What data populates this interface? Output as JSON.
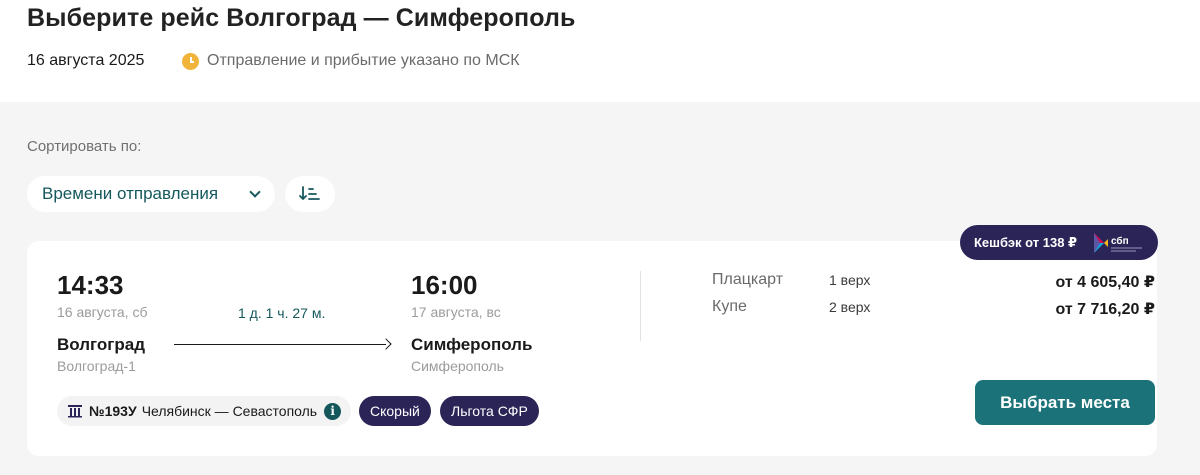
{
  "header": {
    "title": "Выберите рейс Волгоград — Симферополь",
    "date": "16 августа 2025",
    "timezone_note": "Отправление и прибытие указано по МСК"
  },
  "sort": {
    "label": "Сортировать по:",
    "selected": "Времени отправления"
  },
  "trip": {
    "cashback": "Кешбэк от 138 ₽",
    "cashback_logo": "сбп",
    "departure": {
      "time": "14:33",
      "date": "16 августа, сб",
      "city": "Волгоград",
      "station": "Волгоград-1"
    },
    "duration": "1 д. 1 ч. 27 м.",
    "arrival": {
      "time": "16:00",
      "date": "17 августа, вс",
      "city": "Симферополь",
      "station": "Симферополь"
    },
    "classes": [
      {
        "name": "Плацкарт",
        "seats": "1 верх",
        "price": "от 4 605,40 ₽"
      },
      {
        "name": "Купе",
        "seats": "2 верх",
        "price": "от 7 716,20 ₽"
      }
    ],
    "train": {
      "number": "№193У",
      "route": "Челябинск — Севастополь"
    },
    "badges": [
      "Скорый",
      "Льгота СФР"
    ],
    "select_button": "Выбрать места"
  },
  "colors": {
    "accent": "#1b7379",
    "dark_badge": "#2b2457",
    "clock": "#f0b43a"
  },
  "icons": [
    "clock-icon",
    "chevron-down-icon",
    "sort-direction-icon",
    "rail-icon",
    "info-icon",
    "sbp-logo"
  ]
}
